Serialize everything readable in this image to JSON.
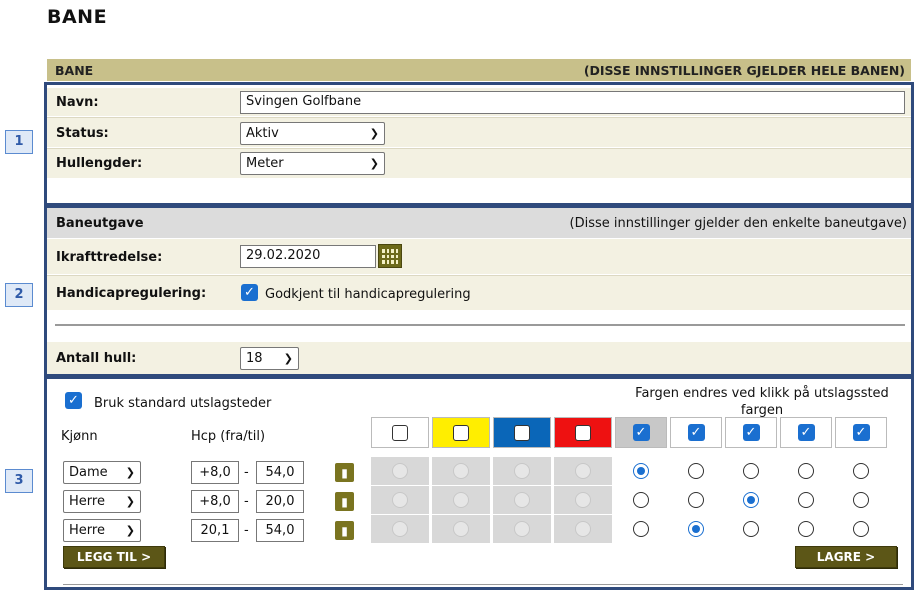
{
  "page": {
    "title": "BANE"
  },
  "bane": {
    "header_left": "BANE",
    "header_right": "(DISSE INNSTILLINGER GJELDER HELE BANEN)",
    "name_label": "Navn:",
    "name_value": "Svingen Golfbane",
    "status_label": "Status:",
    "status_value": "Aktiv",
    "lengths_label": "Hullengder:",
    "lengths_value": "Meter"
  },
  "edition": {
    "header_left": "Baneutgave",
    "header_right": "(Disse innstillinger gjelder den enkelte baneutgave)",
    "effective_label": "Ikrafttredelse:",
    "effective_value": "29.02.2020",
    "handicap_label": "Handicapregulering:",
    "handicap_checkbox_label": "Godkjent til handicapregulering",
    "holes_label": "Antall hull:",
    "holes_value": "18"
  },
  "tees": {
    "standard_label": "Bruk standard utslagsteder",
    "color_hint": "Fargen endres ved klikk på utslagssted fargen",
    "gender_header": "Kjønn",
    "hcp_header": "Hcp (fra/til)",
    "colors": [
      {
        "name": "white",
        "hex": "#ffffff",
        "checked": false
      },
      {
        "name": "yellow",
        "hex": "#ffee00",
        "checked": false
      },
      {
        "name": "blue",
        "hex": "#0a66b8",
        "checked": false
      },
      {
        "name": "red",
        "hex": "#ee1111",
        "checked": false
      },
      {
        "name": "grey",
        "hex": "#c8c8c8",
        "checked": true
      },
      {
        "name": "none",
        "hex": "#ffffff",
        "checked": true
      },
      {
        "name": "none",
        "hex": "#ffffff",
        "checked": true
      },
      {
        "name": "none",
        "hex": "#ffffff",
        "checked": true
      },
      {
        "name": "none",
        "hex": "#ffffff",
        "checked": true
      }
    ],
    "rows": [
      {
        "gender": "Dame",
        "from": "+8,0",
        "to": "54,0",
        "selected": 4
      },
      {
        "gender": "Herre",
        "from": "+8,0",
        "to": "20,0",
        "selected": 6
      },
      {
        "gender": "Herre",
        "from": "20,1",
        "to": "54,0",
        "selected": 5
      }
    ],
    "add_button": "LEGG TIL >",
    "save_button": "LAGRE >",
    "dash": "-"
  },
  "badges": [
    "1",
    "2",
    "3"
  ],
  "accent": {
    "box_border": "#2f4a7c",
    "olive": "#5c5617",
    "header_bg": "#c8c08a"
  }
}
